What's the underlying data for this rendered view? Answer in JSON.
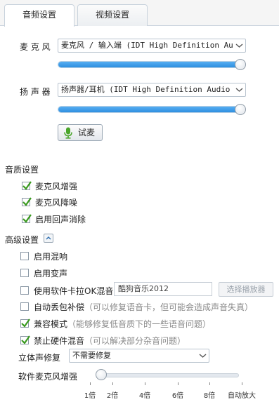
{
  "tabs": [
    {
      "label": "音频设置",
      "active": true
    },
    {
      "label": "视频设置",
      "active": false
    }
  ],
  "mic": {
    "label": "麦 克 风",
    "device": "麦克风 / 输入端 (IDT High Definition Audio CODEC)",
    "level": 1.0
  },
  "speaker": {
    "label": "扬 声 器",
    "device": "扬声器/耳机 (IDT High Definition Audio CODEC)",
    "level": 1.0
  },
  "test_button": {
    "label": "试麦",
    "icon": "microphone-icon"
  },
  "quality": {
    "title": "音质设置",
    "options": [
      {
        "label": "麦克风增强",
        "checked": true
      },
      {
        "label": "麦克风降噪",
        "checked": true
      },
      {
        "label": "启用回声消除",
        "checked": true
      }
    ]
  },
  "advanced": {
    "title": "高级设置",
    "collapse_icon": "chevron-up-icon",
    "reverb": {
      "label": "启用混响",
      "checked": false
    },
    "voice_change": {
      "label": "启用变声",
      "checked": false
    },
    "karaoke": {
      "label": "使用软件卡拉OK混音",
      "checked": false,
      "player": "酷狗音乐2012",
      "select_player_label": "选择播放器"
    },
    "auto_drop": {
      "label": "自动丢包补偿",
      "hint": "（可以修复语音卡，但可能会造成声音失真）",
      "checked": false
    },
    "compat": {
      "label": "兼容模式",
      "hint": "（能够修复低音质下的一些语音问题）",
      "checked": true
    },
    "no_hw_mix": {
      "label": "禁止硬件混音",
      "hint": "（可以解决部分杂音问题）",
      "checked": true
    },
    "stereo": {
      "label": "立体声修复",
      "value": "不需要修复"
    },
    "soft_boost": {
      "label": "软件麦克风增强",
      "level": 0,
      "ticks": [
        "1倍",
        "2倍",
        "4倍",
        "6倍",
        "8倍",
        "自动放大"
      ]
    }
  },
  "colors": {
    "accent": "#2f8fe0",
    "check": "#3a9a1f"
  }
}
